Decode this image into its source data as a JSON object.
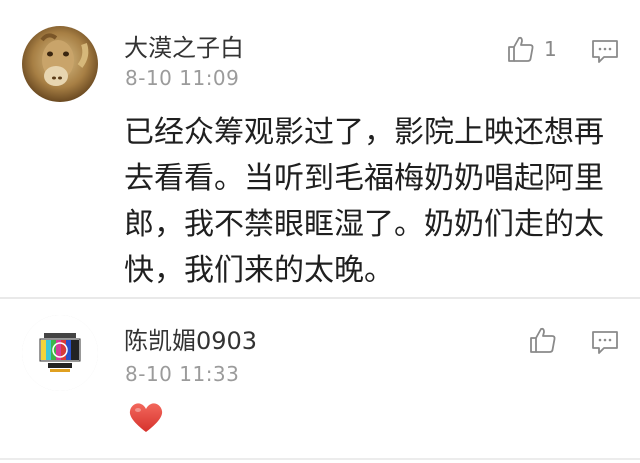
{
  "comments": [
    {
      "username": "大漠之子白",
      "timestamp": "8-10 11:09",
      "likes": "1",
      "body": "已经众筹观影过了，影院上映还想再去看看。当听到毛福梅奶奶唱起阿里郎，我不禁眼眶湿了。奶奶们走的太快，我们来的太晚。",
      "icons": [
        "avatar-camel",
        "thumbs-up-icon",
        "comment-icon"
      ]
    },
    {
      "username": "陈凯媚0903",
      "timestamp": "8-10 11:33",
      "likes": "",
      "reaction": "heart",
      "icons": [
        "avatar-tv-test-pattern",
        "thumbs-up-icon",
        "comment-icon",
        "heart-icon"
      ]
    }
  ],
  "colors": {
    "heart": "#e8403a",
    "meta_text": "#9b9b9b",
    "icon_stroke": "#8a8a8a"
  }
}
